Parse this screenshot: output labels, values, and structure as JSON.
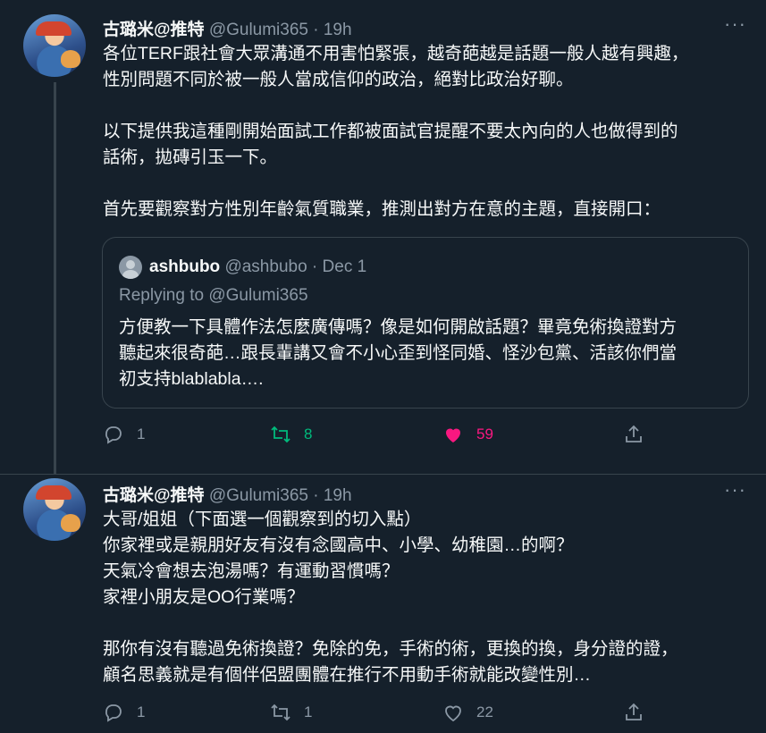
{
  "tweets": [
    {
      "author_name": "古璐米@推特",
      "handle_time": "@Gulumi365 · 19h",
      "text": "各位TERF跟社會大眾溝通不用害怕緊張，越奇葩越是話題一般人越有興趣，\n性別問題不同於被一般人當成信仰的政治，絕對比政治好聊。\n\n以下提供我這種剛開始面試工作都被面試官提醒不要太內向的人也做得到的\n話術，拋磚引玉一下。\n\n首先要觀察對方性別年齡氣質職業，推測出對方在意的主題，直接開口：",
      "quote": {
        "author_name": "ashbubo",
        "handle_date": "@ashbubo · Dec 1",
        "replying_to": "Replying to @Gulumi365",
        "text": "方便教一下具體作法怎麼廣傳嗎？像是如何開啟話題？畢竟免術換證對方\n聽起來很奇葩…跟長輩講又會不小心歪到怪同婚、怪沙包黨、活該你們當\n初支持blablabla…."
      },
      "replies": "1",
      "retweets": "8",
      "likes": "59"
    },
    {
      "author_name": "古璐米@推特",
      "handle_time": "@Gulumi365 · 19h",
      "text": "大哥/姐姐（下面選一個觀察到的切入點）\n你家裡或是親朋好友有沒有念國高中、小學、幼稚園…的啊？\n天氣冷會想去泡湯嗎？有運動習慣嗎？\n家裡小朋友是OO行業嗎？\n\n那你有沒有聽過免術換證？免除的免，手術的術，更換的換，身分證的證，\n顧名思義就是有個伴侶盟團體在推行不用動手術就能改變性別…",
      "replies": "1",
      "retweets": "1",
      "likes": "22"
    }
  ],
  "more_icon": "···",
  "colors": {
    "background": "#15202b",
    "retweet_active": "#00ba7c",
    "like_active": "#f91880"
  }
}
